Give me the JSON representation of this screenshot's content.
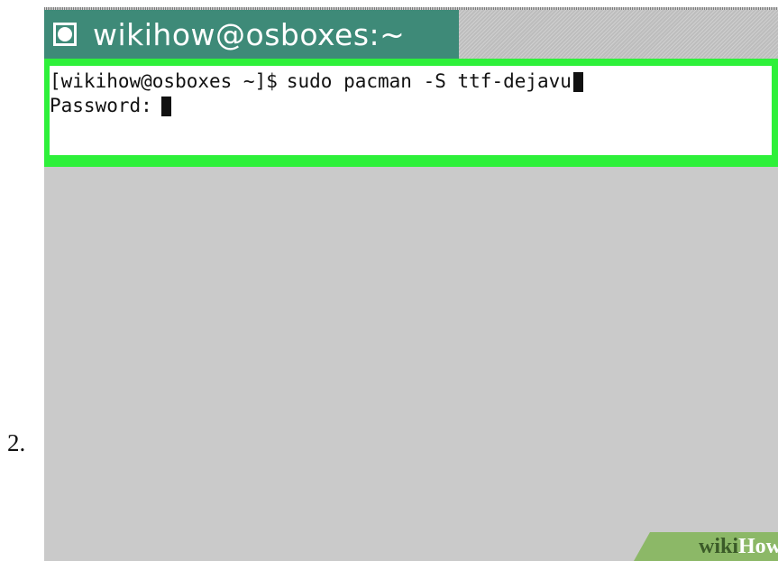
{
  "step": {
    "number": "2."
  },
  "window": {
    "title": "wikihow@osboxes:~",
    "icon": "terminal-window-icon"
  },
  "terminal": {
    "lines": [
      {
        "prompt": "[wikihow@osboxes ~]$",
        "command": "sudo pacman -S ttf-dejavu"
      },
      {
        "prompt": "Password:"
      }
    ]
  },
  "watermark": {
    "part1": "wiki",
    "part2": "How"
  },
  "colors": {
    "tab": "#3e8a78",
    "highlight": "#2ef03a",
    "background": "#cacaca",
    "watermark": "#8cb867"
  }
}
